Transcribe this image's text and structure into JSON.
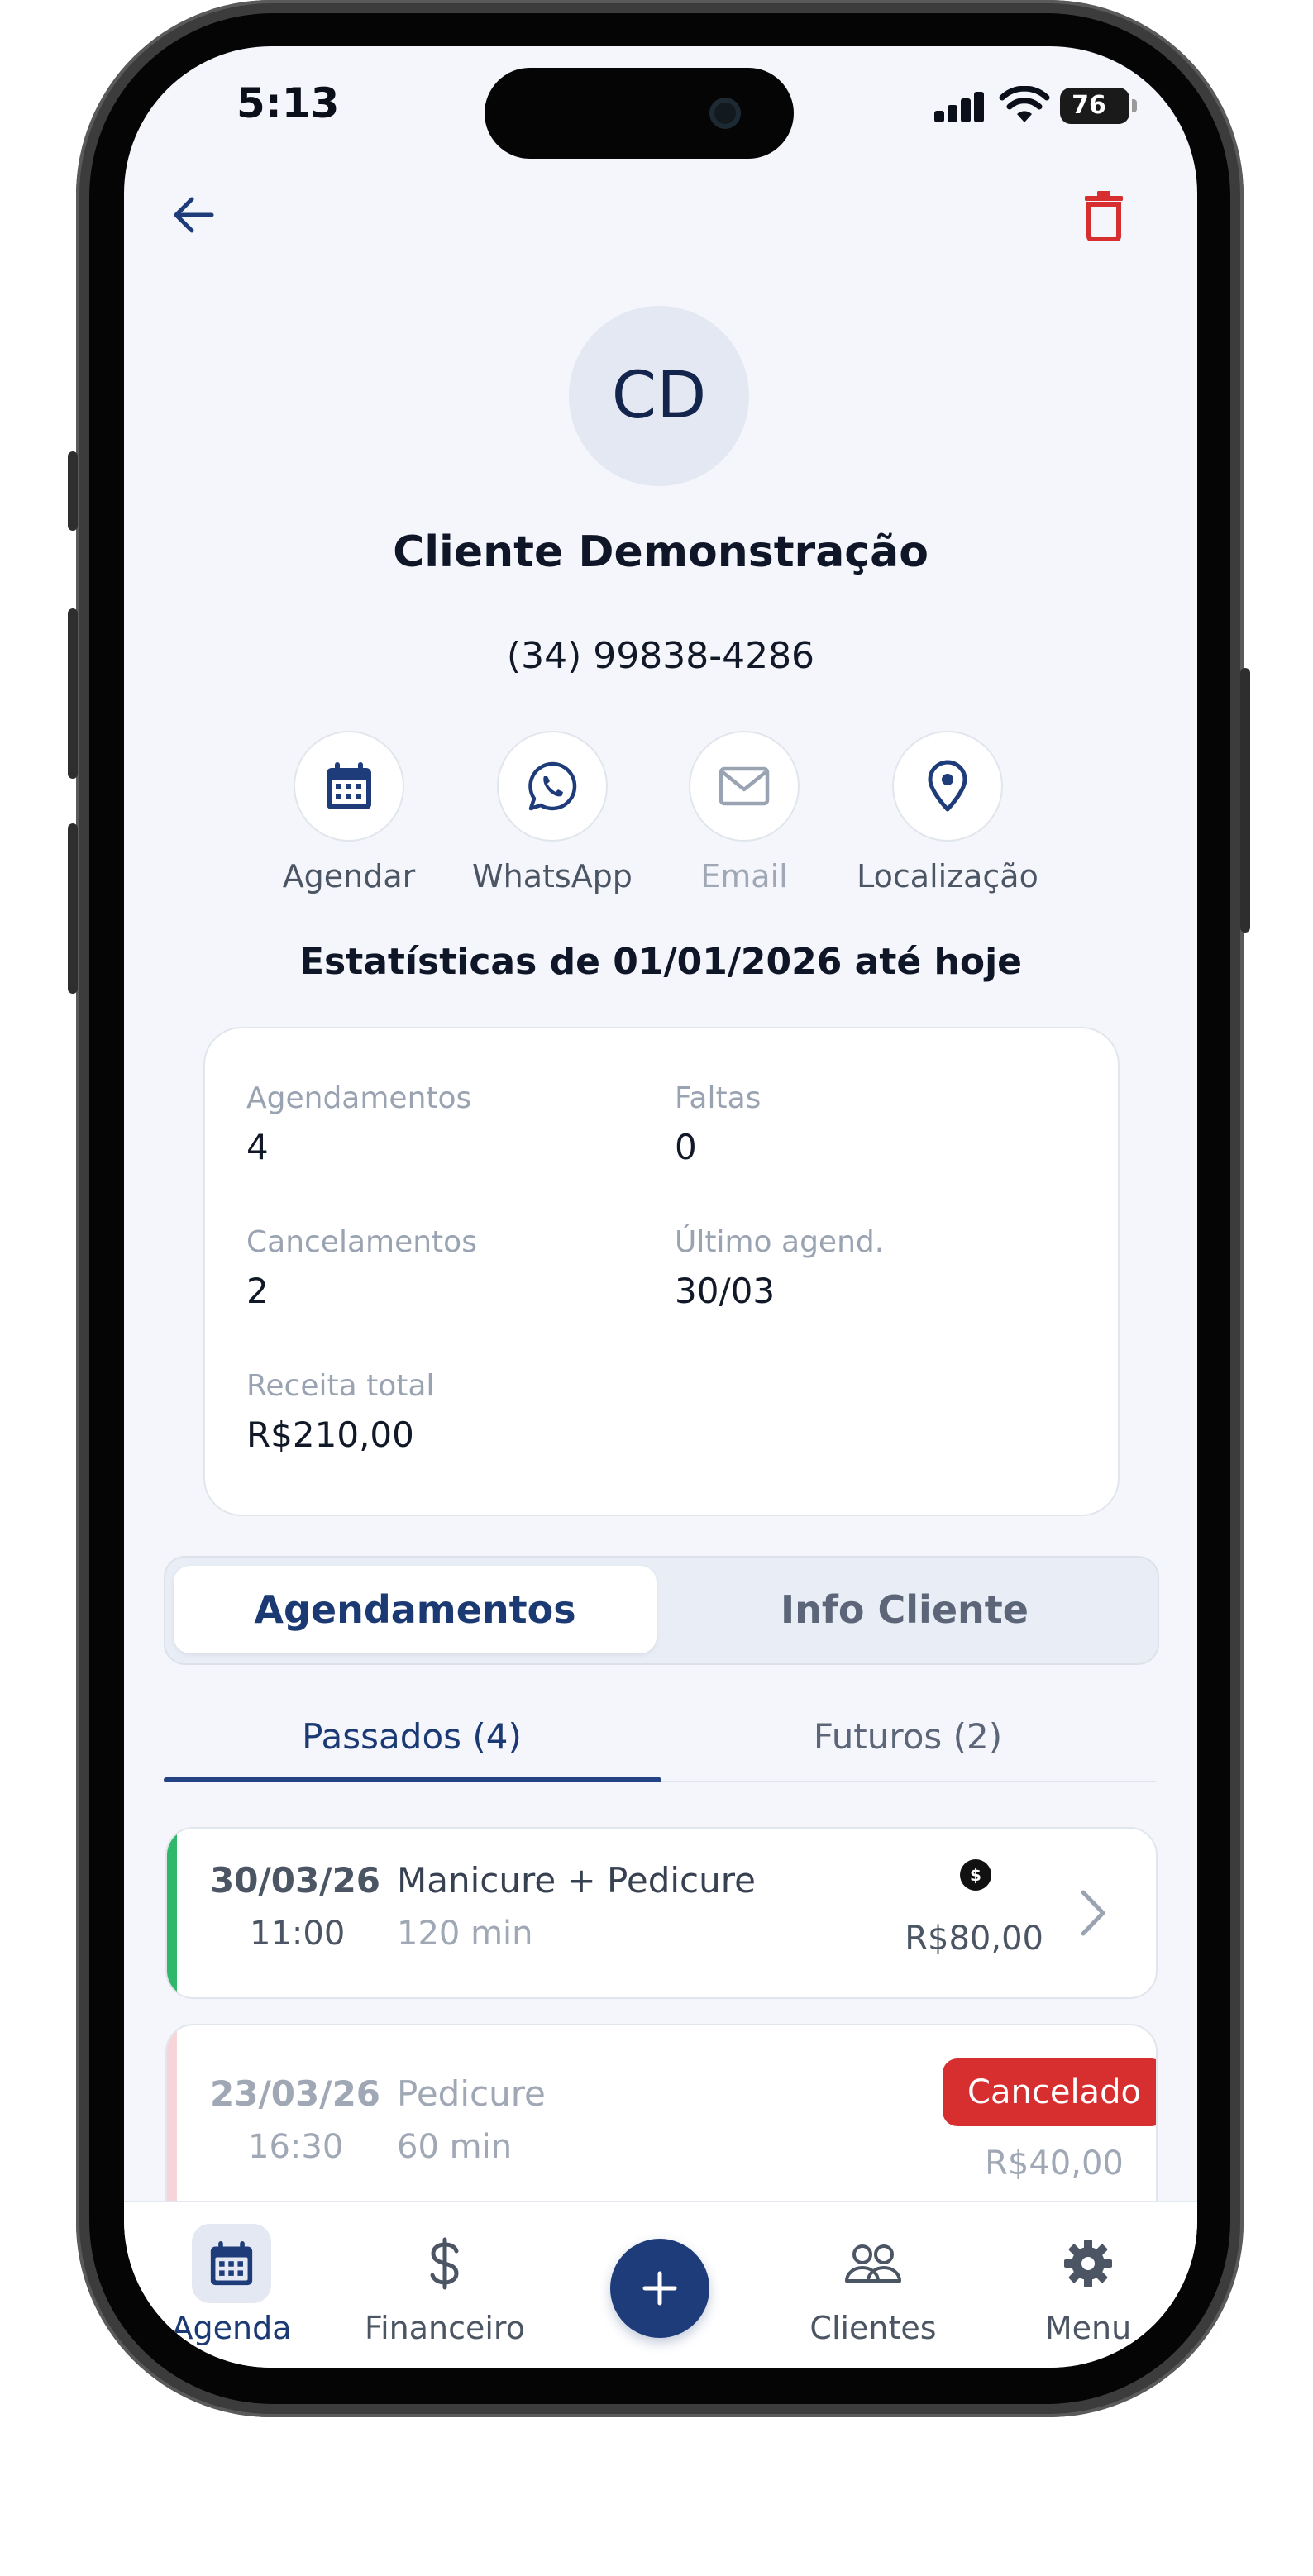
{
  "status_bar": {
    "time": "5:13",
    "battery": "76",
    "icons": [
      "cellular-signal-icon",
      "wifi-icon",
      "battery-icon"
    ]
  },
  "header": {
    "back_icon": "arrow-left-icon",
    "delete_icon": "trash-icon"
  },
  "client": {
    "initials": "CD",
    "name": "Cliente Demonstração",
    "phone": "(34) 99838-4286"
  },
  "actions": [
    {
      "label": "Agendar",
      "icon": "calendar-icon",
      "enabled": true
    },
    {
      "label": "WhatsApp",
      "icon": "whatsapp-icon",
      "enabled": true
    },
    {
      "label": "Email",
      "icon": "mail-icon",
      "enabled": false
    },
    {
      "label": "Localização",
      "icon": "map-pin-icon",
      "enabled": true
    }
  ],
  "stats": {
    "title": "Estatísticas de 01/01/2026 até hoje",
    "items": [
      {
        "label": "Agendamentos",
        "value": "4"
      },
      {
        "label": "Faltas",
        "value": "0"
      },
      {
        "label": "Cancelamentos",
        "value": "2"
      },
      {
        "label": "Último agend.",
        "value": "30/03"
      },
      {
        "label": "Receita total",
        "value": "R$210,00"
      }
    ]
  },
  "segment": {
    "tabs": [
      "Agendamentos",
      "Info Cliente"
    ],
    "active": "Agendamentos"
  },
  "subtabs": {
    "past": "Passados (4)",
    "future": "Futuros (2)",
    "active": "past"
  },
  "appointments": [
    {
      "date": "30/03/26",
      "time": "11:00",
      "service": "Manicure + Pedicure",
      "duration": "120 min",
      "price": "R$80,00",
      "status": "done",
      "paid_icon": "dollar-coin-icon",
      "stripe_color": "#2fb86a"
    },
    {
      "date": "23/03/26",
      "time": "16:30",
      "service": "Pedicure",
      "duration": "60 min",
      "price": "R$40,00",
      "status": "cancelled",
      "badge": "Cancelado",
      "stripe_color": "#f6d4d8"
    }
  ],
  "bottom_nav": {
    "items": [
      {
        "label": "Agenda",
        "icon": "calendar-icon",
        "active": true
      },
      {
        "label": "Financeiro",
        "icon": "dollar-icon",
        "active": false
      },
      {
        "label": "Clientes",
        "icon": "users-icon",
        "active": false
      },
      {
        "label": "Menu",
        "icon": "gear-icon",
        "active": false
      }
    ],
    "fab_icon": "plus-icon"
  },
  "colors": {
    "primary": "#1f3c7a",
    "danger": "#d72f2f",
    "success": "#2fb86a",
    "background": "#f4f6fb"
  }
}
